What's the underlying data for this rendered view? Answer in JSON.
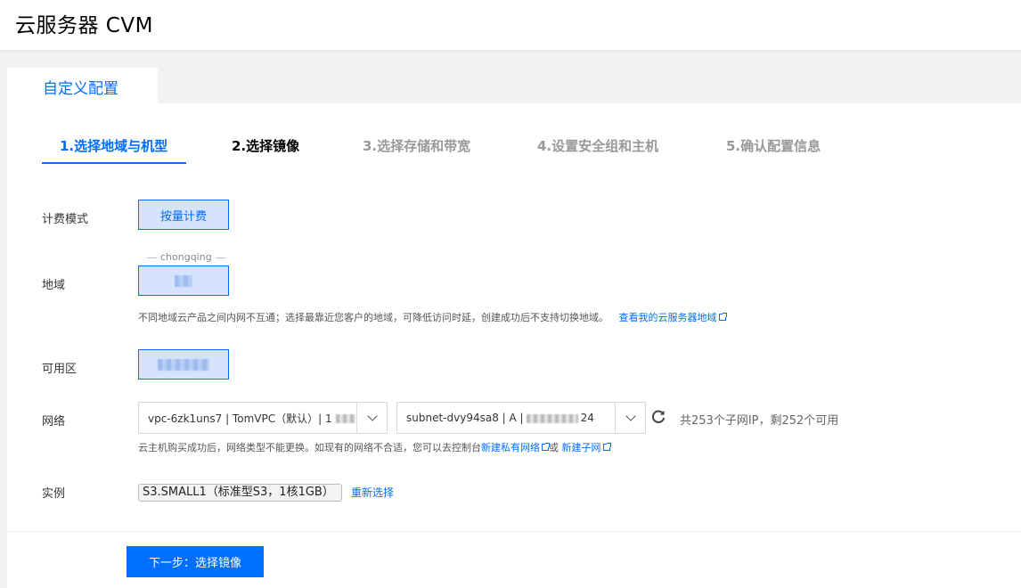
{
  "app": {
    "title": "云服务器 CVM"
  },
  "mode_tab": {
    "label": "自定义配置"
  },
  "steps": [
    {
      "label": "1.选择地域与机型",
      "state": "active"
    },
    {
      "label": "2.选择镜像",
      "state": "next"
    },
    {
      "label": "3.选择存储和带宽",
      "state": "pending"
    },
    {
      "label": "4.设置安全组和主机",
      "state": "pending"
    },
    {
      "label": "5.确认配置信息",
      "state": "pending"
    }
  ],
  "billing": {
    "label": "计费模式",
    "option": "按量计费"
  },
  "region": {
    "label": "地域",
    "caption": "chongqing",
    "hint": "不同地域云产品之间内网不互通；选择最靠近您客户的地域，可降低访问时延，创建成功后不支持切换地域。",
    "link": "查看我的云服务器地域"
  },
  "zone": {
    "label": "可用区"
  },
  "network": {
    "label": "网络",
    "vpc_value": "vpc-6zk1uns7 | TomVPC（默认）| 1",
    "subnet_value": "subnet-dvy94sa8 | A |",
    "subnet_suffix": "24",
    "subnet_count": "共253个子网IP，剩252个可用",
    "hint": "云主机购买成功后，网络类型不能更换。如现有的网络不合适，您可以去控制台",
    "link_vpc": "新建私有网络",
    "or": "或",
    "link_subnet": "新建子网"
  },
  "instance": {
    "label": "实例",
    "value": "S3.SMALL1（标准型S3，1核1GB）",
    "reselect": "重新选择"
  },
  "footer": {
    "next_label": "下一步：选择镜像"
  },
  "colors": {
    "accent": "#006eff",
    "selected_bg": "#d5e4fc"
  }
}
